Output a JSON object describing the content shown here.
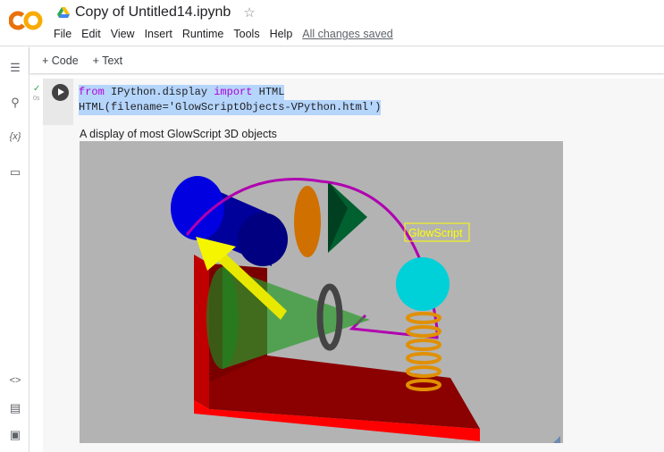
{
  "header": {
    "title": "Copy of Untitled14.ipynb",
    "menu": [
      "File",
      "Edit",
      "View",
      "Insert",
      "Runtime",
      "Tools",
      "Help"
    ],
    "save_status": "All changes saved"
  },
  "toolbar": {
    "add_code": "+ Code",
    "add_text": "+ Text"
  },
  "cell": {
    "exec_time": "0s",
    "code_line1": {
      "kw1": "from",
      "mod": " IPython.display ",
      "kw2": "import",
      "rest": " HTML"
    },
    "code_line2": "HTML(filename='GlowScriptObjects-VPython.html')"
  },
  "output": {
    "caption": "A display of most GlowScript 3D objects",
    "label": "GlowScript"
  },
  "colors": {
    "accent": "#f9ab00",
    "canvas": "#b3b3b3"
  }
}
